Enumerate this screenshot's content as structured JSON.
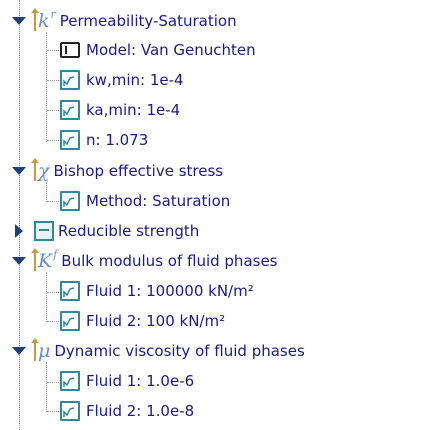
{
  "tree": {
    "permeability": {
      "symbol": "k",
      "symbol_sup": "r",
      "label": "Permeability-Saturation",
      "children": [
        {
          "label": "Model: Van Genuchten",
          "icon": "model-icon"
        },
        {
          "label": "kw,min: 1e-4",
          "icon": "graph-icon"
        },
        {
          "label": "ka,min: 1e-4",
          "icon": "graph-icon"
        },
        {
          "label": "n: 1.073",
          "icon": "graph-icon"
        }
      ]
    },
    "bishop": {
      "symbol": "χ",
      "label": "Bishop effective stress",
      "children": [
        {
          "label": "Method: Saturation",
          "icon": "graph-icon"
        }
      ]
    },
    "reducible": {
      "label": "Reducible strength"
    },
    "bulk": {
      "symbol": "K",
      "symbol_sup": "f",
      "label": "Bulk modulus of fluid phases",
      "children": [
        {
          "label": "Fluid 1: 100000 kN/m²",
          "icon": "graph-icon"
        },
        {
          "label": "Fluid 2: 100 kN/m²",
          "icon": "graph-icon"
        }
      ]
    },
    "viscosity": {
      "symbol": "μ",
      "label": "Dynamic viscosity of fluid phases",
      "children": [
        {
          "label": "Fluid 1: 1.0e-6",
          "icon": "graph-icon"
        },
        {
          "label": "Fluid 2: 1.0e-8",
          "icon": "graph-icon"
        }
      ]
    }
  }
}
